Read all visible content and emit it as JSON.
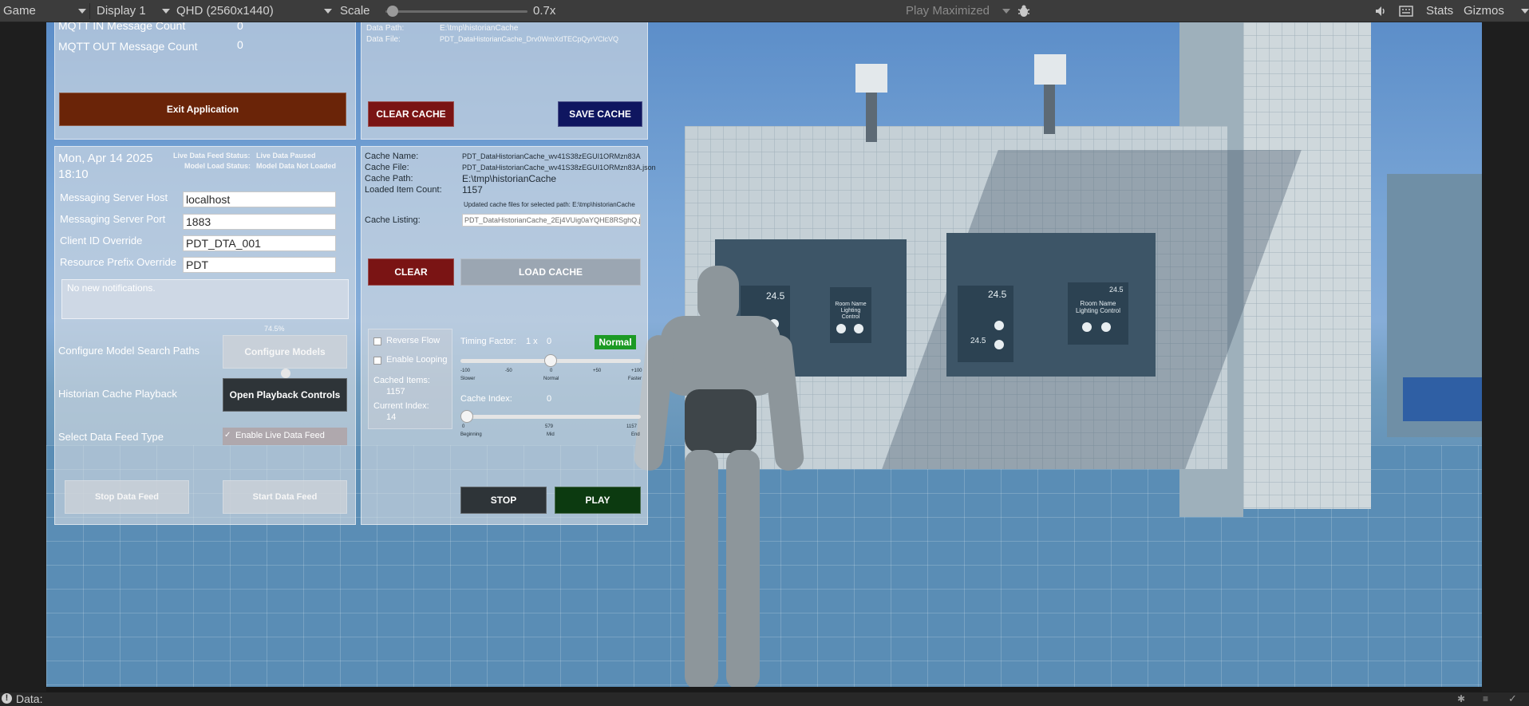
{
  "toolbar": {
    "view_mode": "Game",
    "display": "Display 1",
    "resolution": "QHD (2560x1440)",
    "scale_label": "Scale",
    "scale_value": "0.7x",
    "scale_fraction": 0.01,
    "play_mode": "Play Maximized",
    "stats": "Stats",
    "gizmos": "Gizmos"
  },
  "status": {
    "text": "Data:"
  },
  "mqtt": {
    "in_label": "MQTT IN Message Count",
    "in_value": "0",
    "out_label": "MQTT OUT Message Count",
    "out_value": "0",
    "exit_button": "Exit Application"
  },
  "config": {
    "date": "Mon, Apr 14 2025",
    "time": "18:10",
    "live_status_label": "Live Data Feed Status:",
    "live_status_value": "Live Data Paused",
    "model_status_label": "Model Load Status:",
    "model_status_value": "Model Data Not Loaded",
    "host_label": "Messaging Server Host",
    "host_value": "localhost",
    "port_label": "Messaging Server Port",
    "port_value": "1883",
    "client_label": "Client ID Override",
    "client_value": "PDT_DTA_001",
    "prefix_label": "Resource Prefix Override",
    "prefix_value": "PDT",
    "notification": "No new notifications.",
    "model_paths_label": "Configure Model Search Paths",
    "model_button": "Configure Models",
    "model_percent": "74.5%",
    "playback_label": "Historian Cache Playback",
    "playback_button": "Open Playback Controls",
    "feed_type_label": "Select Data Feed Type",
    "feed_checkbox": "Enable Live Data Feed",
    "stop_feed": "Stop Data Feed",
    "start_feed": "Start Data Feed"
  },
  "cache_top": {
    "path_label": "Data Path:",
    "path_value": "E:\\tmp\\historianCache",
    "file_label": "Data File:",
    "file_value": "PDT_DataHistorianCache_Drv0WmXdTECpQyrVClcVQ",
    "clear_button": "CLEAR CACHE",
    "save_button": "SAVE CACHE"
  },
  "cache": {
    "name_label": "Cache Name:",
    "name_value": "PDT_DataHistorianCache_wv41S38zEGUI1ORMzn83A",
    "file_label": "Cache File:",
    "file_value": "PDT_DataHistorianCache_wv41S38zEGUI1ORMzn83A.json",
    "path_label": "Cache Path:",
    "path_value": "E:\\tmp\\historianCache",
    "count_label": "Loaded Item Count:",
    "count_value": "1157",
    "updated_note": "Updated cache files for selected path: E:\\tmp\\historianCache",
    "listing_label": "Cache Listing:",
    "listing_value": "PDT_DataHistorianCache_2Ej4VUig0aYQHE8RSghQ.json",
    "clear_button": "CLEAR",
    "load_button": "LOAD CACHE"
  },
  "playback": {
    "reverse_label": "Reverse Flow",
    "looping_label": "Enable Looping",
    "cached_items_label": "Cached Items:",
    "cached_items_value": "1157",
    "current_index_label": "Current Index:",
    "current_index_value": "14",
    "timing_label": "Timing Factor:",
    "timing_value": "1 x",
    "timing_offset": "0",
    "timing_fraction": 0.5,
    "speed_badge": "Normal",
    "timing_ticks": [
      "-100",
      "-50",
      "0",
      "+50",
      "+100"
    ],
    "timing_words": [
      "Slower",
      "Normal",
      "Faster"
    ],
    "cache_index_label": "Cache Index:",
    "cache_index_value": "0",
    "index_fraction": 0.0,
    "index_ticks": [
      "0",
      "579",
      "1157"
    ],
    "index_words": [
      "Beginning",
      "Mid",
      "End"
    ],
    "stop_button": "STOP",
    "play_button": "PLAY"
  },
  "scene": {
    "screen1_value": "24.5",
    "screen2_title": "Room Name Lighting Control",
    "screen3_value": "24.5",
    "screen3_value2": "24.5",
    "screen4_value": "24.5",
    "screen4_title": "Room Name Lighting Control"
  },
  "colors": {
    "exit": "#6a2408",
    "clear_cache": "#7a1414",
    "save_cache": "#0f1660",
    "play": "#0c3a10",
    "stop": "#2e3438",
    "badge": "#1c9a24"
  }
}
